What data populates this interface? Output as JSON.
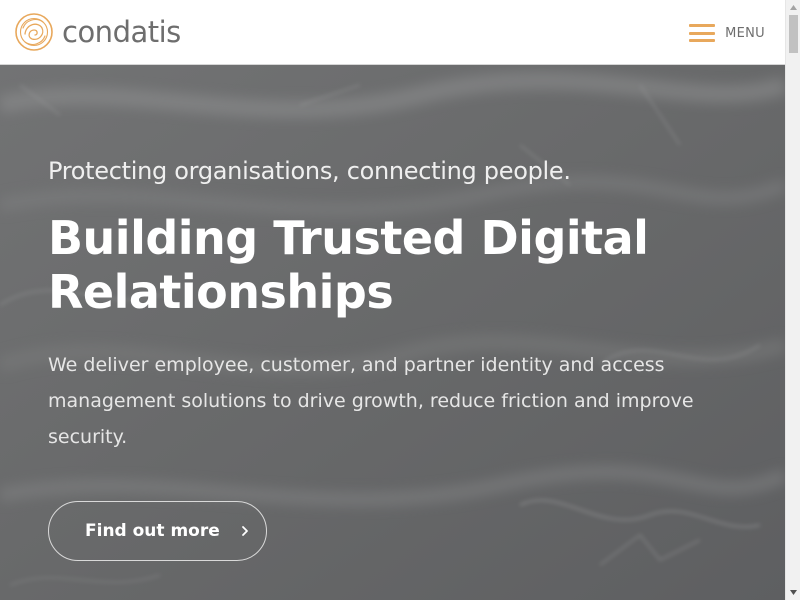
{
  "header": {
    "logo_text": "condatis",
    "menu_label": "MENU"
  },
  "hero": {
    "tagline": "Protecting organisations, connecting people.",
    "title": "Building Trusted Digital Relationships",
    "description": "We deliver employee, customer, and partner identity and access management solutions to drive growth, reduce friction and improve security.",
    "cta_label": "Find out more"
  },
  "icons": {
    "logo": "condatis-logo-icon",
    "menu": "hamburger-icon",
    "cta": "chevron-right-icon"
  },
  "colors": {
    "brand_accent": "#e8a85c",
    "logo_text": "#6e6e6e",
    "hero_background": "#6b6c6d",
    "hero_text": "#ffffff"
  }
}
